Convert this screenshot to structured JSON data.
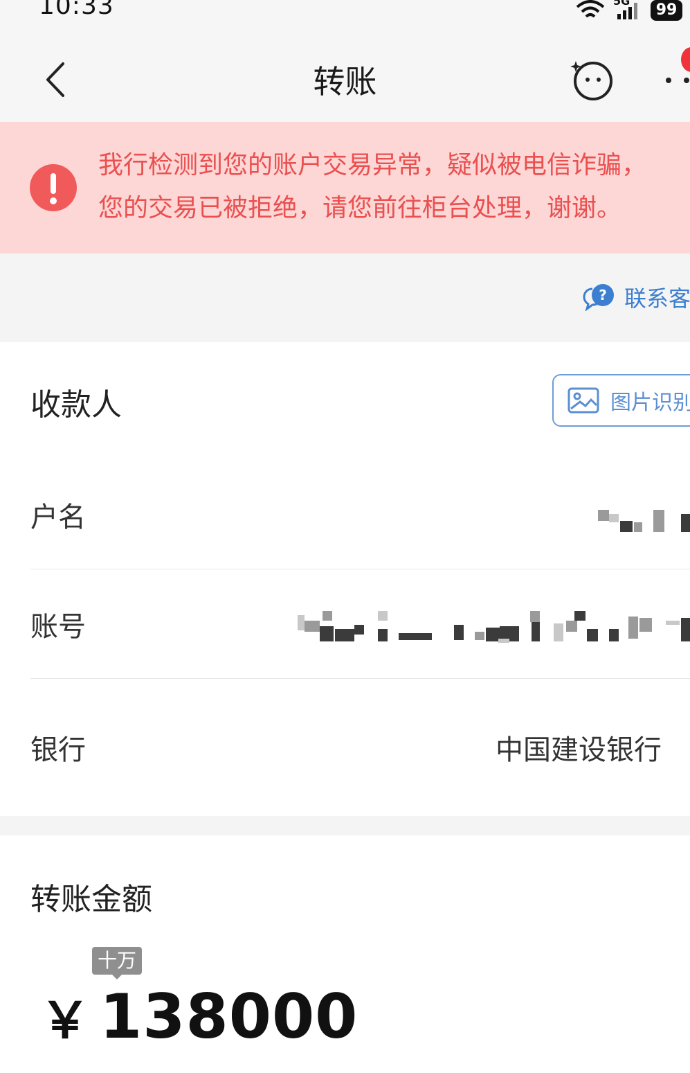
{
  "status_bar": {
    "time": "10:33",
    "network": "5G",
    "battery": "99"
  },
  "nav": {
    "title": "转账",
    "back_icon": "chevron-left-icon",
    "assistant_icon": "smiley-assistant-icon",
    "more_icon": "more-dots-icon"
  },
  "alert": {
    "line1": "我行检测到您的账户交易异常，疑似被电信诈骗，",
    "line2": "您的交易已被拒绝，请您前往柜台处理，谢谢。",
    "color": "#e9504f",
    "background": "#fdd6d6"
  },
  "contact": {
    "label": "联系客"
  },
  "payee": {
    "heading": "收款人",
    "image_recognition_label": "图片识别",
    "name_label": "户名",
    "account_label": "账号",
    "bank_label": "银行",
    "bank_value": "中国建设银行"
  },
  "amount": {
    "heading": "转账金额",
    "unit_tip": "十万",
    "currency": "￥",
    "value": "138000"
  },
  "colors": {
    "accent_blue": "#3c7fd0",
    "alert_red": "#e9504f",
    "badge_red": "#f0333a"
  }
}
